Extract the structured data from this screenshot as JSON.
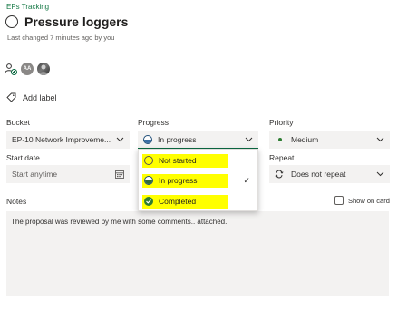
{
  "plan_name": "EPs Tracking",
  "task_title": "Pressure loggers",
  "last_changed": "Last changed 7 minutes ago by you",
  "assignees": [
    {
      "initials": "AA"
    },
    {
      "initials": ""
    }
  ],
  "add_label": "Add label",
  "bucket": {
    "label": "Bucket",
    "value": "EP-10 Network Improveme..."
  },
  "progress": {
    "label": "Progress",
    "value": "In progress",
    "options": [
      {
        "label": "Not started",
        "icon": "not-started-icon",
        "highlighted": true
      },
      {
        "label": "In progress",
        "icon": "in-progress-icon",
        "highlighted": true,
        "selected": true
      },
      {
        "label": "Completed",
        "icon": "completed-icon",
        "highlighted": true
      }
    ]
  },
  "priority": {
    "label": "Priority",
    "value": "Medium"
  },
  "start_date": {
    "label": "Start date",
    "placeholder": "Start anytime"
  },
  "repeat": {
    "label": "Repeat",
    "value": "Does not repeat"
  },
  "notes": {
    "label": "Notes",
    "value": "The proposal was reviewed by me with some comments.. attached."
  },
  "show_on_card": "Show on card",
  "colors": {
    "accent": "#0b6a42",
    "highlight": "#ffff00",
    "plan_link": "#1b7c4a"
  }
}
